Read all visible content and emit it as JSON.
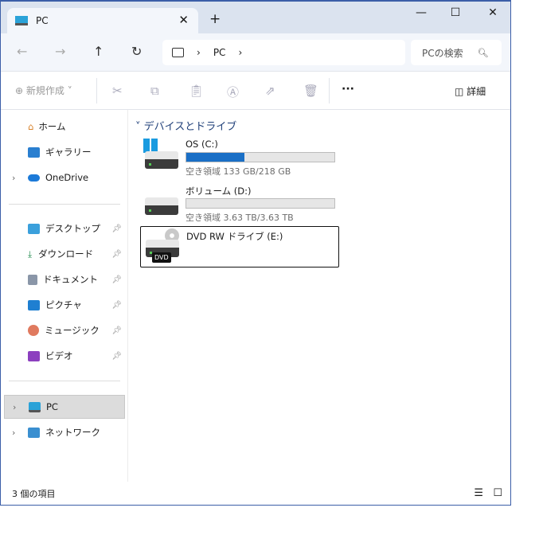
{
  "tab": {
    "title": "PC"
  },
  "address": {
    "path": [
      "PC"
    ],
    "search_placeholder": "PCの検索"
  },
  "toolbar": {
    "new_label": "新規作成",
    "details_label": "詳細"
  },
  "sidebar": {
    "home": "ホーム",
    "gallery": "ギャラリー",
    "onedrive": "OneDrive",
    "pinned": [
      "デスクトップ",
      "ダウンロード",
      "ドキュメント",
      "ピクチャ",
      "ミュージック",
      "ビデオ"
    ],
    "pc": "PC",
    "network": "ネットワーク"
  },
  "main": {
    "group_title": "デバイスとドライブ",
    "drives": [
      {
        "name": "OS (C:)",
        "free_text": "空き領域 133 GB/218 GB",
        "used_fraction": 0.39
      },
      {
        "name": "ボリューム (D:)",
        "free_text": "空き領域 3.63 TB/3.63 TB",
        "used_fraction": 0.0
      },
      {
        "name": "DVD RW ドライブ (E:)",
        "badge": "DVD"
      }
    ]
  },
  "status": {
    "count": "3 個の項目"
  },
  "colors": {
    "accent": "#1a6fc6"
  }
}
